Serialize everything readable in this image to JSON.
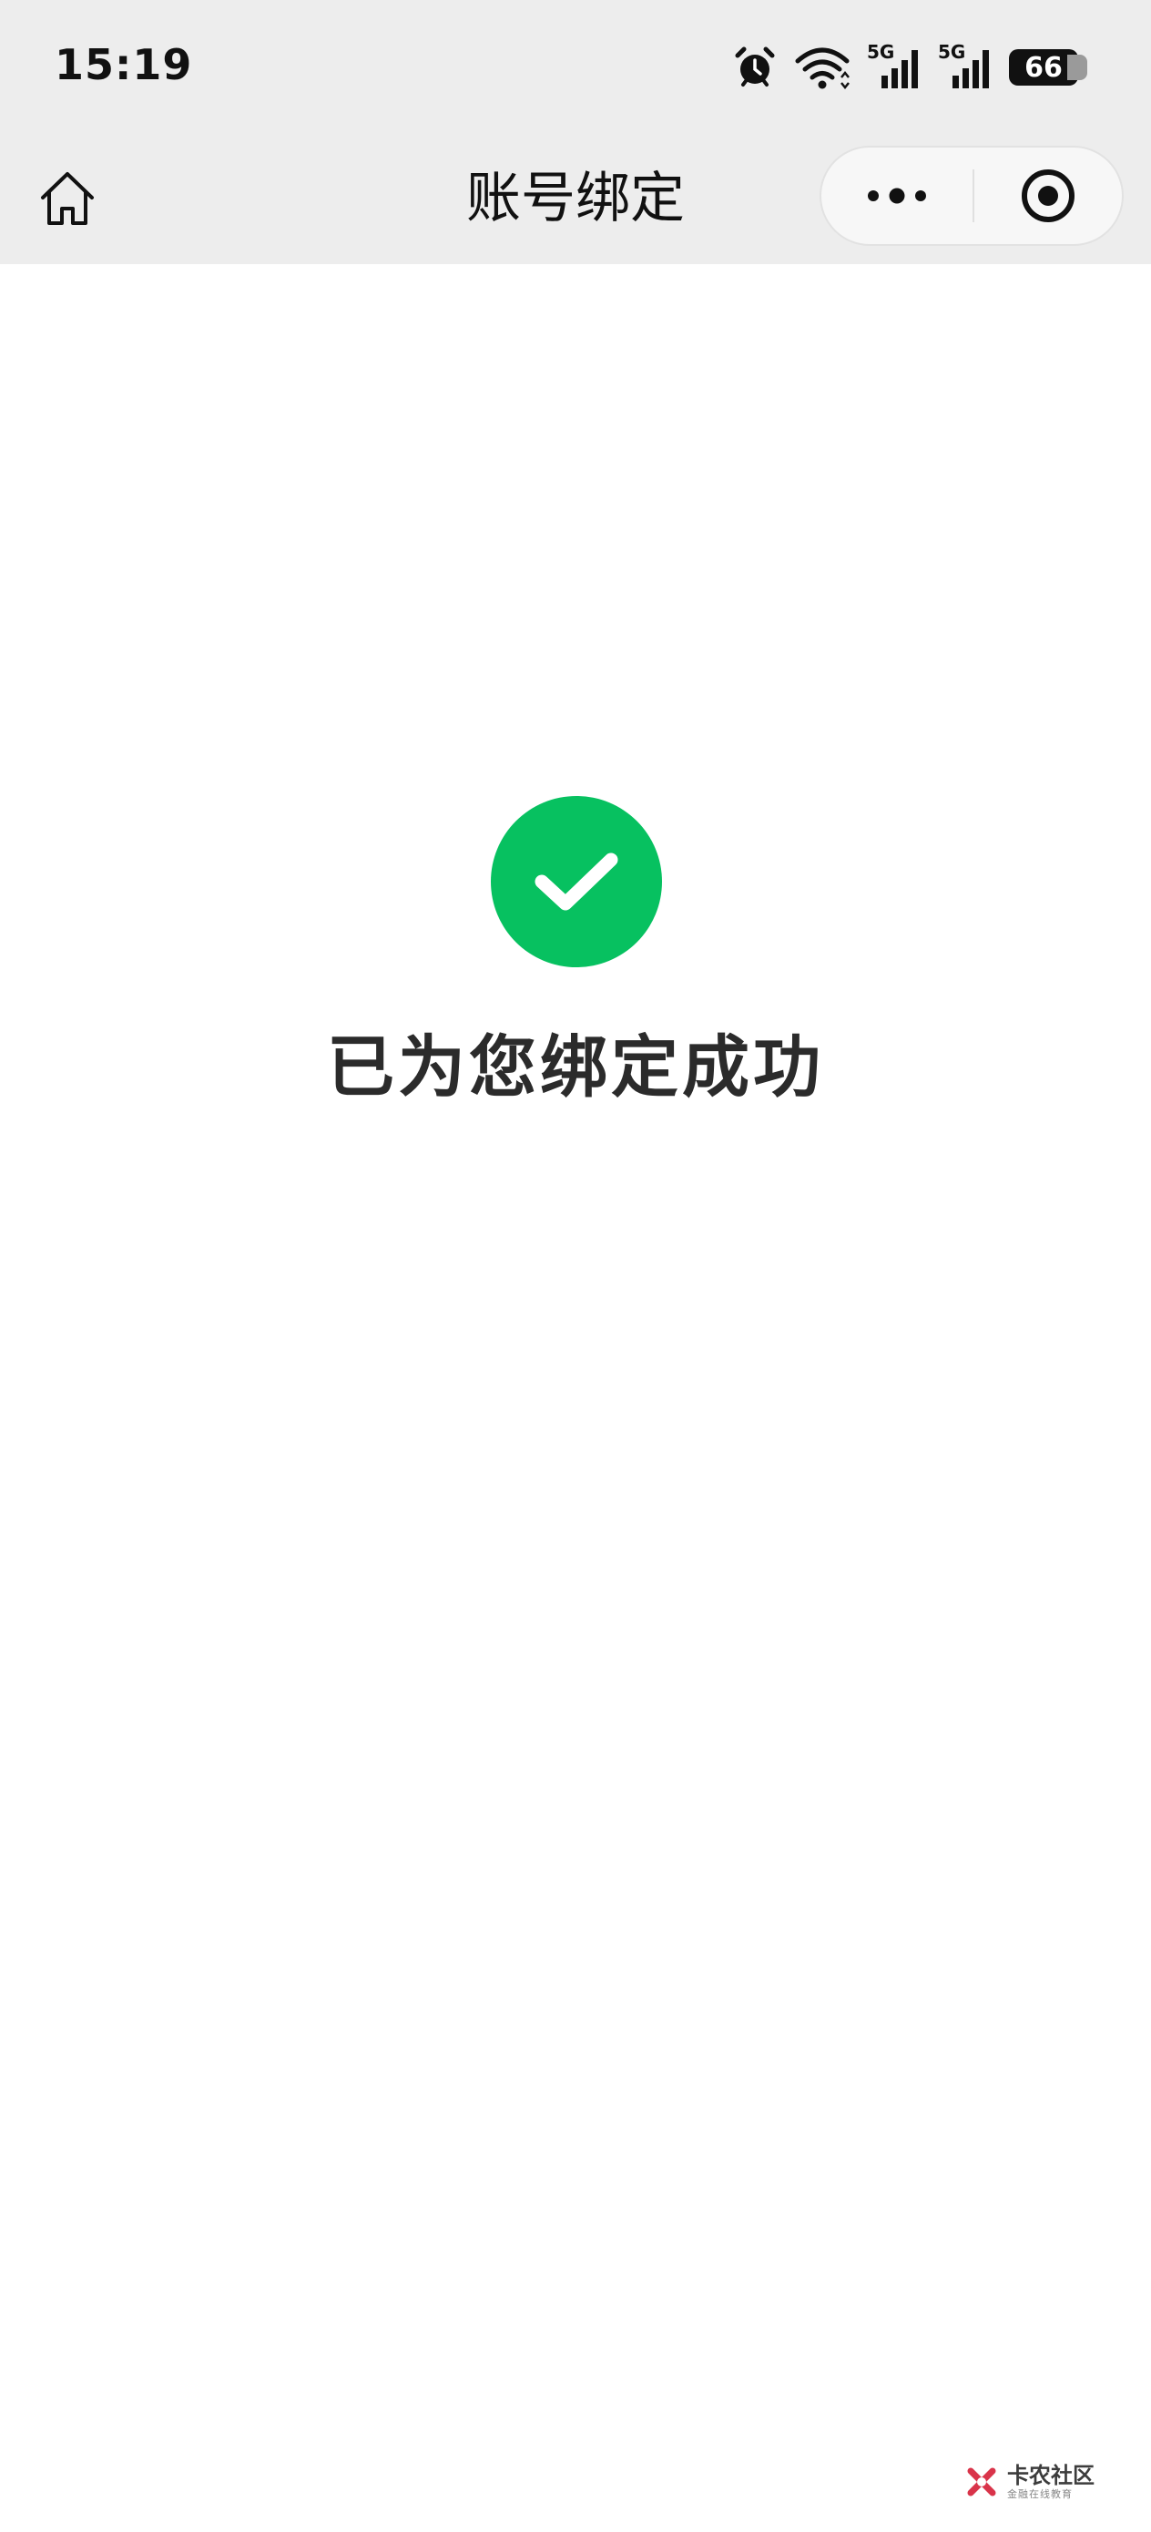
{
  "status_bar": {
    "time": "15:19",
    "icons": [
      "alarm-icon",
      "wifi-icon",
      "signal-5g-icon",
      "signal-5g-icon",
      "battery-icon"
    ],
    "network_labels": [
      "5G",
      "5G"
    ],
    "battery_level": "66"
  },
  "nav_bar": {
    "title": "账号绑定",
    "home_icon": "home-icon",
    "more_icon": "more-dots-icon",
    "close_icon": "target-circle-icon"
  },
  "main": {
    "status_icon": "checkmark-circle-icon",
    "message": "已为您绑定成功"
  },
  "watermark": {
    "title": "卡农社区",
    "subtitle": "金融在线教育"
  },
  "colors": {
    "success": "#07c160",
    "topbar_bg": "#ededed",
    "page_bg": "#ffffff",
    "watermark_red": "#d9344a"
  }
}
